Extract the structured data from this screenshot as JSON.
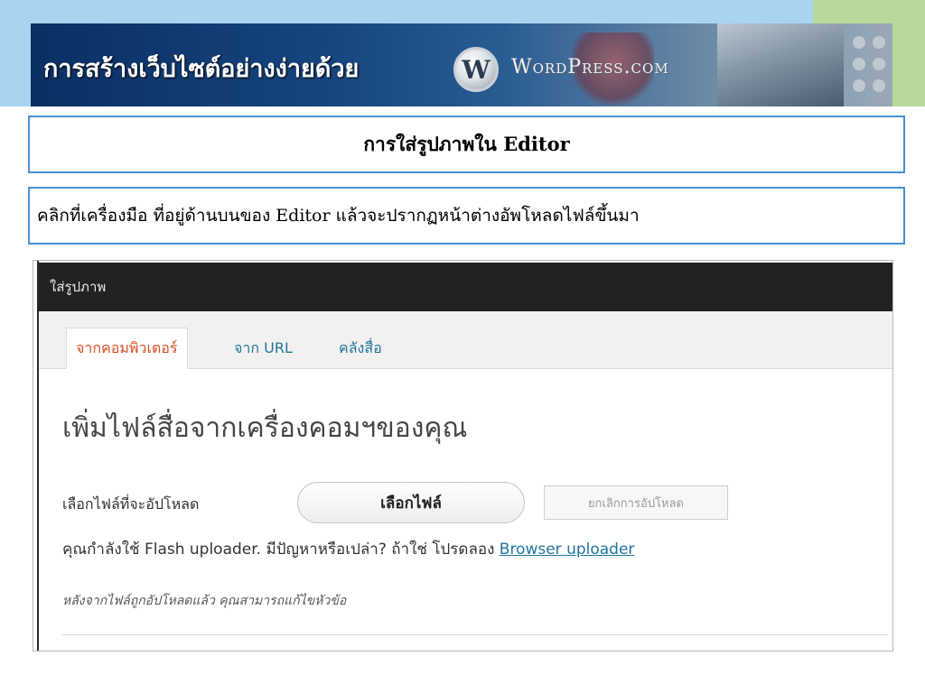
{
  "banner": {
    "title": "การสร้างเว็บไซต์อย่างง่ายด้วย",
    "logo_letter": "W",
    "brand": "WordPress.com"
  },
  "slide": {
    "heading": "การใส่รูปภาพใน Editor",
    "instruction": "คลิกที่เครื่องมือ  ที่อยู่ด้านบนของ Editor แล้วจะปรากฏหน้าต่างอัพโหลดไฟล์ขึ้นมา"
  },
  "dialog": {
    "title": "ใส่รูปภาพ",
    "tabs": [
      {
        "label": "จากคอมพิวเตอร์",
        "active": true
      },
      {
        "label": "จาก URL",
        "active": false
      },
      {
        "label": "คลังสื่อ",
        "active": false
      }
    ],
    "heading": "เพิ่มไฟล์สื่อจากเครื่องคอมฯของคุณ",
    "choose_label": "เลือกไฟล์ที่จะอัปโหลด",
    "select_button": "เลือกไฟล์",
    "cancel_button": "ยกเลิกการอัปโหลด",
    "flash_text": "คุณกำลังใช้ Flash uploader. มีปัญหาหรือเปล่า? ถ้าใช่ โปรดลอง ",
    "browser_link": "Browser uploader",
    "hint": "หลังจากไฟล์ถูกอัปโหลดแล้ว คุณสามารถแก้ไขหัวข้อ"
  },
  "colors": {
    "accent_border": "#4a8fd0",
    "active_tab": "#d54e21",
    "link": "#21759b",
    "titlebar": "#222222"
  }
}
